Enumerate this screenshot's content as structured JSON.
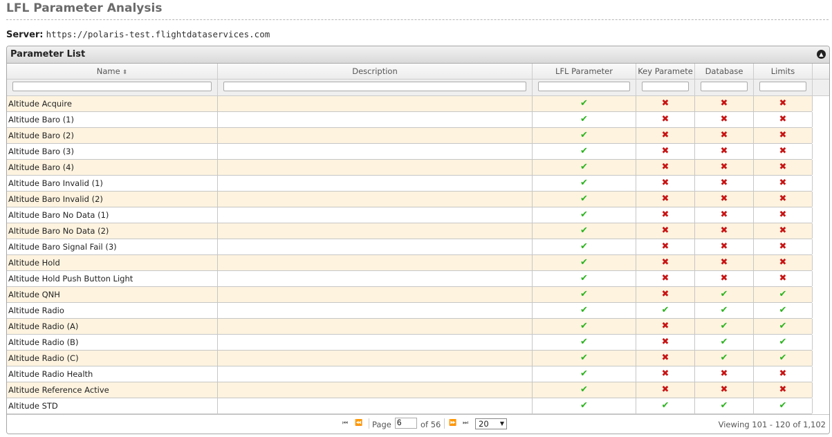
{
  "page": {
    "title": "LFL Parameter Analysis",
    "server_label": "Server:",
    "server_url": "https://polaris-test.flightdataservices.com"
  },
  "grid": {
    "caption": "Parameter List",
    "columns": [
      {
        "key": "name",
        "label": "Name"
      },
      {
        "key": "description",
        "label": "Description"
      },
      {
        "key": "lfl",
        "label": "LFL Parameter"
      },
      {
        "key": "key",
        "label": "Key Paramete"
      },
      {
        "key": "database",
        "label": "Database"
      },
      {
        "key": "limits",
        "label": "Limits"
      }
    ],
    "rows": [
      {
        "name": "Altitude Acquire",
        "description": "",
        "lfl": true,
        "key": false,
        "database": false,
        "limits": false
      },
      {
        "name": "Altitude Baro (1)",
        "description": "",
        "lfl": true,
        "key": false,
        "database": false,
        "limits": false
      },
      {
        "name": "Altitude Baro (2)",
        "description": "",
        "lfl": true,
        "key": false,
        "database": false,
        "limits": false
      },
      {
        "name": "Altitude Baro (3)",
        "description": "",
        "lfl": true,
        "key": false,
        "database": false,
        "limits": false
      },
      {
        "name": "Altitude Baro (4)",
        "description": "",
        "lfl": true,
        "key": false,
        "database": false,
        "limits": false
      },
      {
        "name": "Altitude Baro Invalid (1)",
        "description": "",
        "lfl": true,
        "key": false,
        "database": false,
        "limits": false
      },
      {
        "name": "Altitude Baro Invalid (2)",
        "description": "",
        "lfl": true,
        "key": false,
        "database": false,
        "limits": false
      },
      {
        "name": "Altitude Baro No Data (1)",
        "description": "",
        "lfl": true,
        "key": false,
        "database": false,
        "limits": false
      },
      {
        "name": "Altitude Baro No Data (2)",
        "description": "",
        "lfl": true,
        "key": false,
        "database": false,
        "limits": false
      },
      {
        "name": "Altitude Baro Signal Fail (3)",
        "description": "",
        "lfl": true,
        "key": false,
        "database": false,
        "limits": false
      },
      {
        "name": "Altitude Hold",
        "description": "",
        "lfl": true,
        "key": false,
        "database": false,
        "limits": false
      },
      {
        "name": "Altitude Hold Push Button Light",
        "description": "",
        "lfl": true,
        "key": false,
        "database": false,
        "limits": false
      },
      {
        "name": "Altitude QNH",
        "description": "",
        "lfl": true,
        "key": false,
        "database": true,
        "limits": true
      },
      {
        "name": "Altitude Radio",
        "description": "",
        "lfl": true,
        "key": true,
        "database": true,
        "limits": true
      },
      {
        "name": "Altitude Radio (A)",
        "description": "",
        "lfl": true,
        "key": false,
        "database": true,
        "limits": true
      },
      {
        "name": "Altitude Radio (B)",
        "description": "",
        "lfl": true,
        "key": false,
        "database": true,
        "limits": true
      },
      {
        "name": "Altitude Radio (C)",
        "description": "",
        "lfl": true,
        "key": false,
        "database": true,
        "limits": true
      },
      {
        "name": "Altitude Radio Health",
        "description": "",
        "lfl": true,
        "key": false,
        "database": false,
        "limits": false
      },
      {
        "name": "Altitude Reference Active",
        "description": "",
        "lfl": true,
        "key": false,
        "database": false,
        "limits": false
      },
      {
        "name": "Altitude STD",
        "description": "",
        "lfl": true,
        "key": true,
        "database": true,
        "limits": true
      }
    ]
  },
  "pager": {
    "page_label": "Page",
    "current_page": "6",
    "of_label": "of 56",
    "page_size": "20",
    "viewing_text": "Viewing 101 - 120 of 1,102"
  },
  "icons": {
    "check": "✔",
    "cross": "✖",
    "first": "⏮",
    "prev": "⏪",
    "next": "⏩",
    "last": "⏭"
  },
  "colors": {
    "check": "#2bb31e",
    "cross": "#c81414",
    "odd_row": "#fdf3df"
  }
}
